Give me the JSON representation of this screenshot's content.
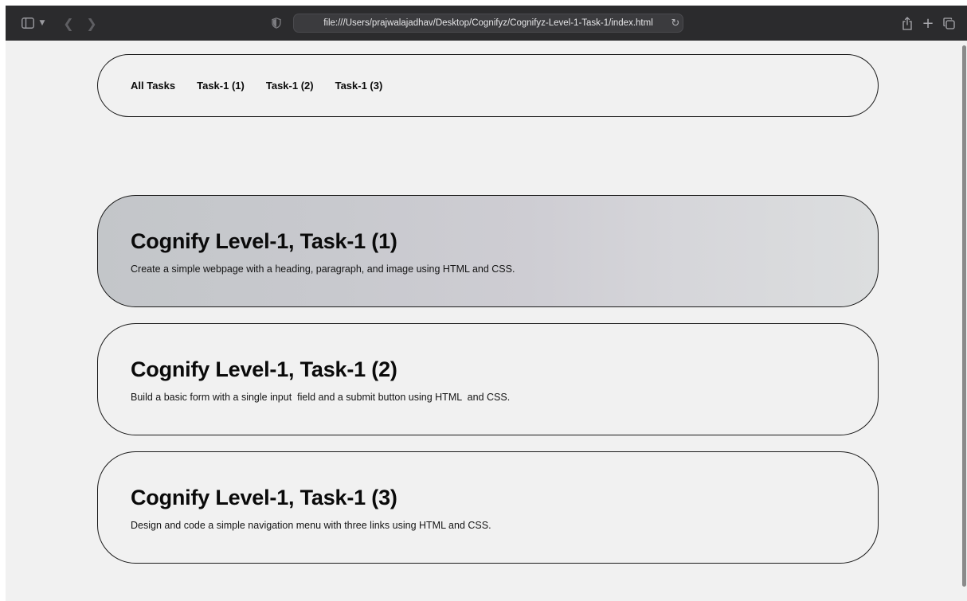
{
  "browser": {
    "address": "file:///Users/prajwalajadhav/Desktop/Cognifyz/Cognifyz-Level-1-Task-1/index.html",
    "icons": {
      "sidebar": "sidebar-icon",
      "chevron": "chevron-down-icon",
      "back": "back-arrow-icon",
      "forward": "forward-arrow-icon",
      "privacy": "shield-icon",
      "reload": "reload-icon",
      "share": "share-icon",
      "new_tab": "plus-icon",
      "tabs": "tabs-overview-icon"
    }
  },
  "nav": {
    "links": [
      {
        "label": "All Tasks"
      },
      {
        "label": "Task-1 (1)"
      },
      {
        "label": "Task-1 (2)"
      },
      {
        "label": "Task-1 (3)"
      }
    ]
  },
  "cards": [
    {
      "title": "Cognify Level-1, Task-1 (1)",
      "description": "Create a simple webpage with a heading, paragraph, and image using HTML and CSS."
    },
    {
      "title": "Cognify Level-1, Task-1 (2)",
      "description": "Build a basic form with a single input  field and a submit button using HTML  and CSS."
    },
    {
      "title": "Cognify Level-1, Task-1 (3)",
      "description": "Design and code a simple navigation menu with three links using HTML and CSS."
    }
  ],
  "colors": {
    "toolbar": "#2b2b2d",
    "page_background": "#f1f1f1",
    "border": "#1a1a1a",
    "text": "#0a0a0a"
  }
}
